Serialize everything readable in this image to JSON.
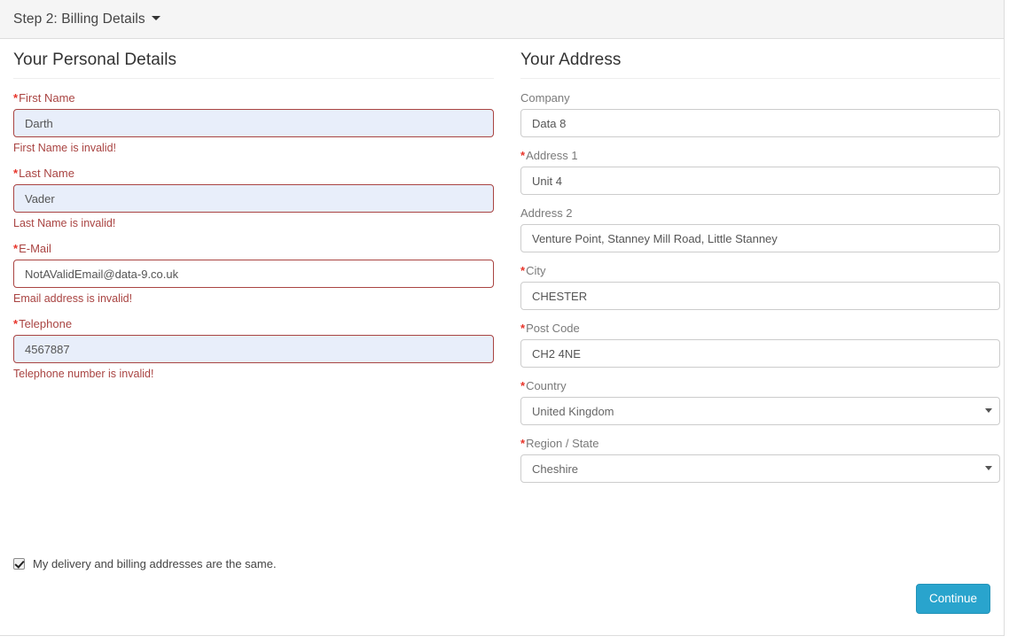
{
  "panel": {
    "title": "Step 2: Billing Details",
    "caret_icon": "caret-down-icon"
  },
  "personal": {
    "heading": "Your Personal Details",
    "fields": [
      {
        "label": "First Name",
        "required": true,
        "value": "Darth",
        "error": "First Name is invalid!",
        "state": "error-autofill"
      },
      {
        "label": "Last Name",
        "required": true,
        "value": "Vader",
        "error": "Last Name is invalid!",
        "state": "error-autofill"
      },
      {
        "label": "E-Mail",
        "required": true,
        "value": "NotAValidEmail@data-9.co.uk",
        "error": "Email address is invalid!",
        "state": "error"
      },
      {
        "label": "Telephone",
        "required": true,
        "value": "4567887",
        "error": "Telephone number is invalid!",
        "state": "error-autofill"
      }
    ]
  },
  "address": {
    "heading": "Your Address",
    "fields": [
      {
        "label": "Company",
        "required": false,
        "value": "Data 8",
        "type": "text"
      },
      {
        "label": "Address 1",
        "required": true,
        "value": "Unit 4",
        "type": "text"
      },
      {
        "label": "Address 2",
        "required": false,
        "value": "Venture Point, Stanney Mill Road, Little Stanney",
        "type": "text"
      },
      {
        "label": "City",
        "required": true,
        "value": "CHESTER",
        "type": "text"
      },
      {
        "label": "Post Code",
        "required": true,
        "value": "CH2 4NE",
        "type": "text"
      },
      {
        "label": "Country",
        "required": true,
        "value": "United Kingdom",
        "type": "select",
        "caret_icon": "chevron-down-icon"
      },
      {
        "label": "Region / State",
        "required": true,
        "value": "Cheshire",
        "type": "select",
        "caret_icon": "chevron-down-icon"
      }
    ]
  },
  "footer": {
    "shipping_same_label": "My delivery and billing addresses are the same.",
    "shipping_same_checked": true,
    "continue_label": "Continue"
  },
  "colors": {
    "primary_button": "#29a4cd",
    "error_text": "#a94442",
    "required_star": "#e8342a",
    "autofill_bg": "#e8eefa",
    "header_bg": "#f5f5f5",
    "border": "#dddddd"
  }
}
